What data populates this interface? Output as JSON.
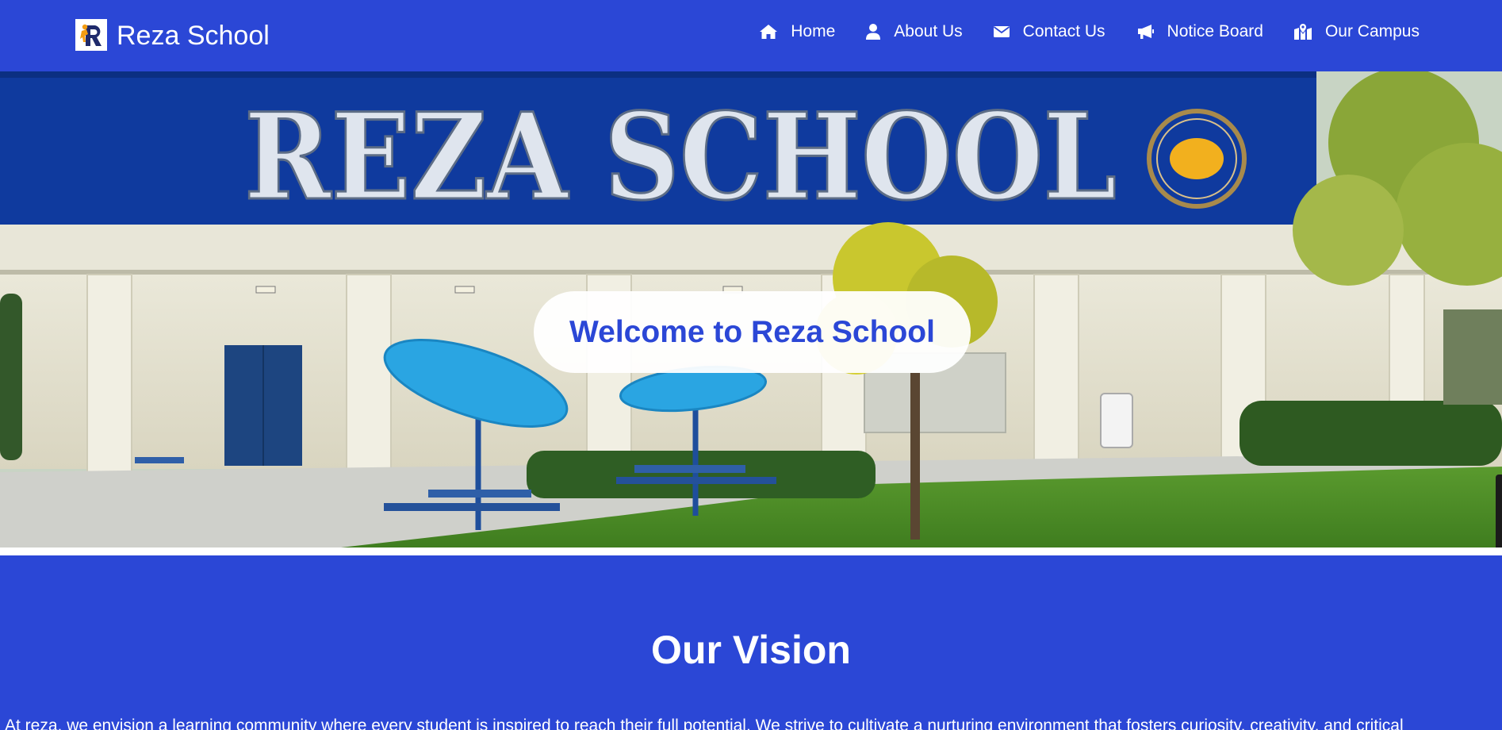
{
  "navbar": {
    "brand_name": "Reza School",
    "logo_icon": "reza-r-logo",
    "background": "#2b47d6",
    "items": [
      {
        "label": "Home",
        "icon": "home-icon"
      },
      {
        "label": "About Us",
        "icon": "user-icon"
      },
      {
        "label": "Contact Us",
        "icon": "envelope-icon"
      },
      {
        "label": "Notice Board",
        "icon": "bullhorn-icon"
      },
      {
        "label": "Our Campus",
        "icon": "map-location-icon"
      }
    ]
  },
  "hero": {
    "image_sign_text": "REZA SCHOOL",
    "welcome_text": "Welcome to Reza School"
  },
  "vision": {
    "title": "Our Vision",
    "text": "At reza, we envision a learning community where every student is inspired to reach their full potential. We strive to cultivate a nurturing environment that fosters curiosity, creativity, and critical"
  },
  "colors": {
    "accent": "#2b47d6",
    "text_on_accent": "#ffffff"
  }
}
